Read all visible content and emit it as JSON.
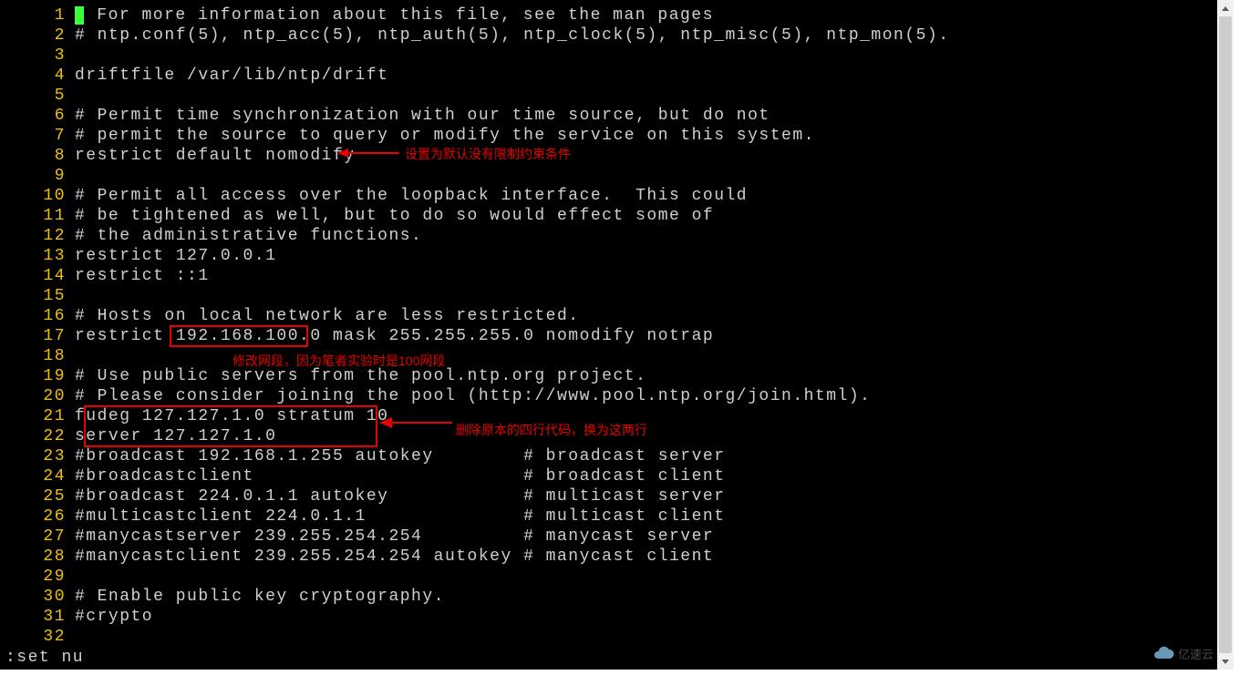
{
  "editor": {
    "status_line": ":set nu",
    "lines": [
      {
        "n": "1",
        "text": "# For more information about this file, see the man pages",
        "cursor": true
      },
      {
        "n": "2",
        "text": "# ntp.conf(5), ntp_acc(5), ntp_auth(5), ntp_clock(5), ntp_misc(5), ntp_mon(5)."
      },
      {
        "n": "3",
        "text": ""
      },
      {
        "n": "4",
        "text": "driftfile /var/lib/ntp/drift"
      },
      {
        "n": "5",
        "text": ""
      },
      {
        "n": "6",
        "text": "# Permit time synchronization with our time source, but do not"
      },
      {
        "n": "7",
        "text": "# permit the source to query or modify the service on this system."
      },
      {
        "n": "8",
        "text": "restrict default nomodify"
      },
      {
        "n": "9",
        "text": ""
      },
      {
        "n": "10",
        "text": "# Permit all access over the loopback interface.  This could"
      },
      {
        "n": "11",
        "text": "# be tightened as well, but to do so would effect some of"
      },
      {
        "n": "12",
        "text": "# the administrative functions."
      },
      {
        "n": "13",
        "text": "restrict 127.0.0.1"
      },
      {
        "n": "14",
        "text": "restrict ::1"
      },
      {
        "n": "15",
        "text": ""
      },
      {
        "n": "16",
        "text": "# Hosts on local network are less restricted."
      },
      {
        "n": "17",
        "text": "restrict 192.168.100.0 mask 255.255.255.0 nomodify notrap"
      },
      {
        "n": "18",
        "text": ""
      },
      {
        "n": "19",
        "text": "# Use public servers from the pool.ntp.org project."
      },
      {
        "n": "20",
        "text": "# Please consider joining the pool (http://www.pool.ntp.org/join.html)."
      },
      {
        "n": "21",
        "text": "fudeg 127.127.1.0 stratum 10"
      },
      {
        "n": "22",
        "text": "server 127.127.1.0"
      },
      {
        "n": "23",
        "text": "#broadcast 192.168.1.255 autokey        # broadcast server"
      },
      {
        "n": "24",
        "text": "#broadcastclient                        # broadcast client"
      },
      {
        "n": "25",
        "text": "#broadcast 224.0.1.1 autokey            # multicast server"
      },
      {
        "n": "26",
        "text": "#multicastclient 224.0.1.1              # multicast client"
      },
      {
        "n": "27",
        "text": "#manycastserver 239.255.254.254         # manycast server"
      },
      {
        "n": "28",
        "text": "#manycastclient 239.255.254.254 autokey # manycast client"
      },
      {
        "n": "29",
        "text": ""
      },
      {
        "n": "30",
        "text": "# Enable public key cryptography."
      },
      {
        "n": "31",
        "text": "#crypto"
      },
      {
        "n": "32",
        "text": ""
      }
    ]
  },
  "annotations": {
    "a1": "设置为默认没有限制约束条件",
    "a2": "修改网段，因为笔者实验时是100网段",
    "a3": "删除原本的四行代码，换为这两行"
  },
  "watermark": {
    "text": "亿速云"
  }
}
